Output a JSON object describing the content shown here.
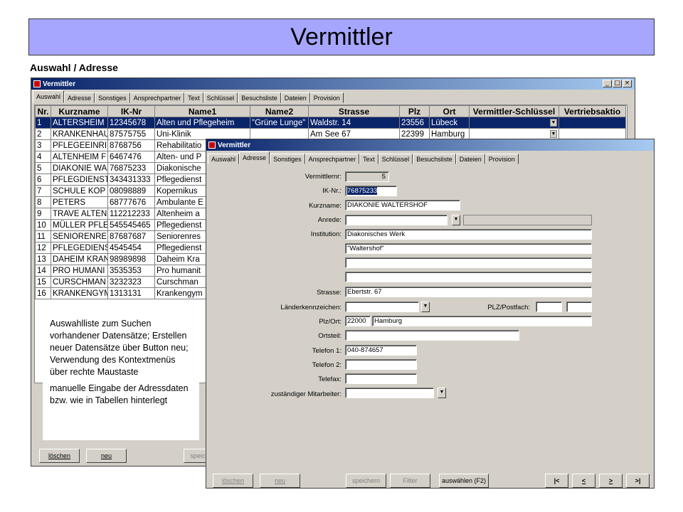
{
  "header": {
    "title": "Vermittler",
    "subtitle": "Auswahl / Adresse"
  },
  "back_window": {
    "title": "Vermittler",
    "window_buttons": [
      "_",
      "□",
      "×"
    ],
    "tabs": [
      "Auswahl",
      "Adresse",
      "Sonstiges",
      "Ansprechpartner",
      "Text",
      "Schlüssel",
      "Besuchsliste",
      "Dateien",
      "Provision"
    ],
    "active_tab": "Auswahl",
    "columns": [
      "Nr.",
      "Kurzname",
      "IK-Nr",
      "Name1",
      "Name2",
      "Strasse",
      "Plz",
      "Ort",
      "Vermittler-Schlüssel",
      "Vertriebsaktio"
    ],
    "rows": [
      [
        "1",
        "ALTERSHEIM",
        "12345678",
        "Alten und Pflegeheim",
        "\"Grüne Lunge\"",
        "Waldstr. 14",
        "23556",
        "Lübeck"
      ],
      [
        "2",
        "KRANKENHAU",
        "87575755",
        "Uni-Klinik",
        "",
        "Am See 67",
        "22399",
        "Hamburg"
      ],
      [
        "3",
        "PFLEGEEINRI",
        "8768756",
        "Rehabilitatio",
        "",
        "",
        "",
        ""
      ],
      [
        "4",
        "ALTENHEIM F",
        "6467476",
        "Alten- und P",
        "",
        "",
        "",
        ""
      ],
      [
        "5",
        "DIAKONIE WA",
        "76875233",
        "Diakonische",
        "",
        "",
        "",
        ""
      ],
      [
        "6",
        "PFLEGDIENST",
        "343431333",
        "Pflegedienst",
        "",
        "",
        "",
        ""
      ],
      [
        "7",
        "SCHULE KOP",
        "08098889",
        "Kopernikus",
        "",
        "",
        "",
        ""
      ],
      [
        "8",
        "PETERS",
        "68777676",
        "Ambulante E",
        "",
        "",
        "",
        ""
      ],
      [
        "9",
        "TRAVE ALTEN",
        "112212233",
        "Altenheim a",
        "",
        "",
        "",
        ""
      ],
      [
        "10",
        "MÜLLER PFLE",
        "545545465",
        "Pflegedienst",
        "",
        "",
        "",
        ""
      ],
      [
        "11",
        "SENIORENRE",
        "87687687",
        "Seniorenres",
        "",
        "",
        "",
        ""
      ],
      [
        "12",
        "PFLEGEDIENS",
        "4545454",
        "Pflegedienst",
        "",
        "",
        "",
        ""
      ],
      [
        "13",
        "DAHEIM KRAN",
        "98989898",
        "Daheim Kra",
        "",
        "",
        "",
        ""
      ],
      [
        "14",
        "PRO HUMANI",
        "3535353",
        "Pro humanit",
        "",
        "",
        "",
        ""
      ],
      [
        "15",
        "CURSCHMAN",
        "3232323",
        "Curschman",
        "",
        "",
        "",
        ""
      ],
      [
        "16",
        "KRANKENGYM",
        "1313131",
        "Krankengym",
        "",
        "",
        "",
        ""
      ]
    ],
    "buttons": {
      "delete": "löschen",
      "new": "neu",
      "save": "speic"
    }
  },
  "note": {
    "paragraph1": "Auswahlliste zum Suchen vorhandener Datensätze; Erstellen neuer Datensätze über Button neu; Verwendung des Kontextmenüs über rechte Maustaste",
    "paragraph2": "manuelle Eingabe der Adressdaten bzw. wie in Tabellen hinterlegt"
  },
  "front_window": {
    "title": "Vermittler",
    "tabs": [
      "Auswahl",
      "Adresse",
      "Sonstiges",
      "Ansprechpartner",
      "Text",
      "Schlüssel",
      "Besuchsliste",
      "Dateien",
      "Provision"
    ],
    "active_tab": "Adresse",
    "form": {
      "vermittlernr_label": "Vermittlernr:",
      "vermittlernr": "5",
      "ik_label": "IK-Nr.:",
      "ik": "76875233",
      "kurzname_label": "Kurzname:",
      "kurzname": "DIAKONIE WALTERSHOF",
      "anrede_label": "Anrede:",
      "anrede": "",
      "institution_label": "Institution:",
      "institution_1": "Diakonisches Werk",
      "institution_2": "\"Waltershof\"",
      "institution_3": "",
      "institution_4": "",
      "strasse_label": "Strasse:",
      "strasse": "Ebertstr. 67",
      "laenderkennzeichen_label": "Länderkennzeichen:",
      "laenderkennzeichen": "",
      "plz_postfach_label": "PLZ/Postfach:",
      "plz_ort_label": "Plz/Ort:",
      "plz": "22000",
      "ort": "Hamburg",
      "ortsteil_label": "Ortsteil:",
      "ortsteil": "",
      "telefon1_label": "Telefon 1:",
      "telefon1": "040-874657",
      "telefon2_label": "Telefon 2:",
      "telefon2": "",
      "telefax_label": "Telefax:",
      "telefax": "",
      "mitarbeiter_label": "zuständiger Mitarbeiter:",
      "mitarbeiter": ""
    },
    "buttons": {
      "delete": "löschen",
      "new": "neu",
      "save": "speichern",
      "filter": "Filter",
      "select": "auswählen (F2)",
      "first": "|<",
      "prev": "<",
      "next": ">",
      "last": ">|"
    }
  }
}
